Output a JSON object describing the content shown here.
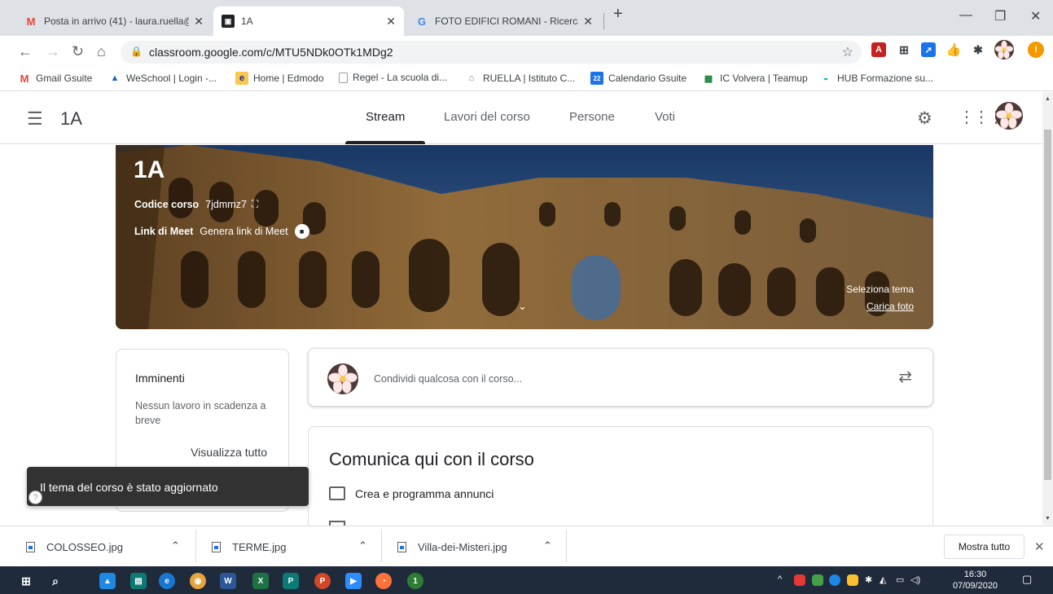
{
  "browser": {
    "tabs": [
      {
        "title": "Posta in arrivo (41) - laura.ruella@",
        "icon": "gmail-icon"
      },
      {
        "title": "1A",
        "icon": "classroom-icon"
      },
      {
        "title": "FOTO EDIFICI ROMANI - Ricerca",
        "icon": "google-icon"
      }
    ],
    "url": "classroom.google.com/c/MTU5NDk0OTk1MDg2",
    "bookmarks": [
      {
        "label": "Gmail Gsuite",
        "icon": "gmail-icon"
      },
      {
        "label": "WeSchool | Login -...",
        "icon": "weschool-icon"
      },
      {
        "label": "Home | Edmodo",
        "icon": "edmodo-icon"
      },
      {
        "label": "Regel - La scuola di...",
        "icon": "page-icon"
      },
      {
        "label": "RUELLA | Istituto C...",
        "icon": "institute-icon"
      },
      {
        "label": "Calendario Gsuite",
        "icon": "calendar-icon"
      },
      {
        "label": "IC Volvera | Teamup",
        "icon": "teamup-icon"
      },
      {
        "label": "HUB Formazione su...",
        "icon": "hub-icon"
      }
    ]
  },
  "classroom": {
    "course_name": "1A",
    "nav_tabs": [
      "Stream",
      "Lavori del corso",
      "Persone",
      "Voti"
    ],
    "active_tab": "Stream",
    "banner": {
      "title": "1A",
      "course_code_label": "Codice corso",
      "course_code": "7jdmmz7",
      "meet_label": "Link di Meet",
      "meet_link": "Genera link di Meet",
      "select_theme": "Seleziona tema",
      "upload_photo": "Carica foto"
    },
    "upcoming": {
      "title": "Imminenti",
      "text": "Nessun lavoro in scadenza a breve",
      "link": "Visualizza tutto"
    },
    "share_placeholder": "Condividi qualcosa con il corso...",
    "announce": {
      "title": "Comunica qui con il corso",
      "item": "Crea e programma annunci"
    },
    "toast": "Il tema del corso è stato aggiornato"
  },
  "downloads": {
    "files": [
      "COLOSSEO.jpg",
      "TERME.jpg",
      "Villa-dei-Misteri.jpg"
    ],
    "show_all": "Mostra tutto"
  },
  "taskbar": {
    "time": "16:30",
    "date": "07/09/2020"
  }
}
